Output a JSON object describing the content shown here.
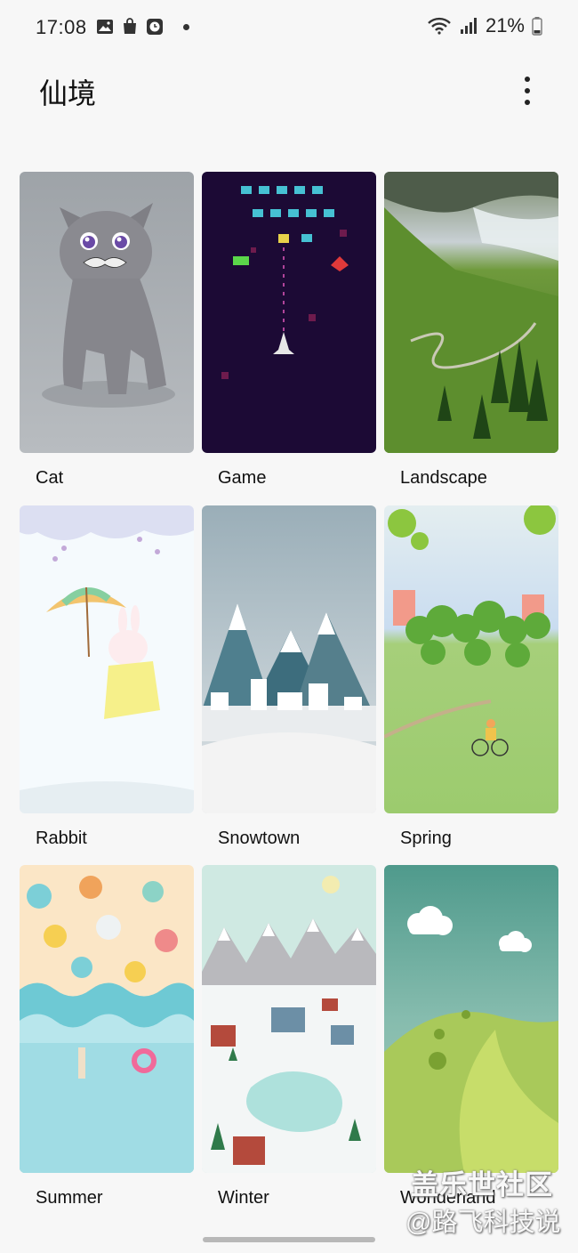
{
  "status_bar": {
    "time": "17:08",
    "battery": "21%",
    "left_icons": [
      "gallery-icon",
      "shopping-bag-icon",
      "clock-app-icon",
      "dot-icon"
    ],
    "right_icons": [
      "wifi-icon",
      "signal-icon",
      "battery-icon"
    ]
  },
  "app_bar": {
    "title": "仙境",
    "menu_icon": "more-vert-icon"
  },
  "themes": [
    {
      "label": "Cat"
    },
    {
      "label": "Game"
    },
    {
      "label": "Landscape"
    },
    {
      "label": "Rabbit"
    },
    {
      "label": "Snowtown"
    },
    {
      "label": "Spring"
    },
    {
      "label": "Summer"
    },
    {
      "label": "Winter"
    },
    {
      "label": "Wonderland"
    }
  ],
  "watermark": {
    "line1": "盖乐世社区",
    "line2": "@路飞科技说"
  }
}
